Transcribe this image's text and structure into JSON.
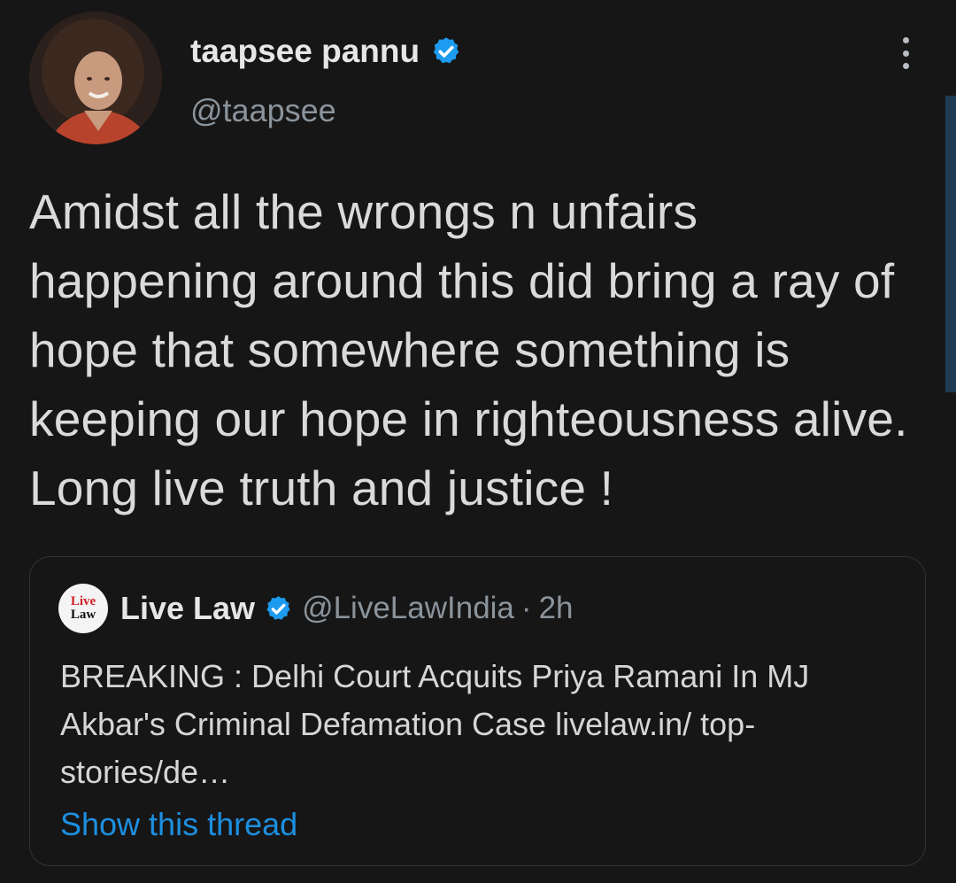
{
  "tweet": {
    "display_name": "taapsee pannu",
    "handle": "@taapsee",
    "text": "Amidst all the wrongs n unfairs happening around this did bring a ray of hope that somewhere something is keeping our hope in righteousness alive. Long live truth and justice !",
    "verified_icon": "verified-badge-icon",
    "more_icon": "more-vertical-icon"
  },
  "quoted": {
    "avatar_line1": "Live",
    "avatar_line2": "Law",
    "display_name": "Live Law",
    "handle": "@LiveLawIndia",
    "separator": "·",
    "time": "2h",
    "text": "BREAKING : Delhi Court Acquits Priya Ramani In MJ Akbar's Criminal Defamation Case livelaw.in/ top-stories/de…",
    "show_thread": "Show this thread"
  },
  "colors": {
    "background": "#161616",
    "accent": "#1d8fe0",
    "secondary_text": "#8b949c"
  }
}
